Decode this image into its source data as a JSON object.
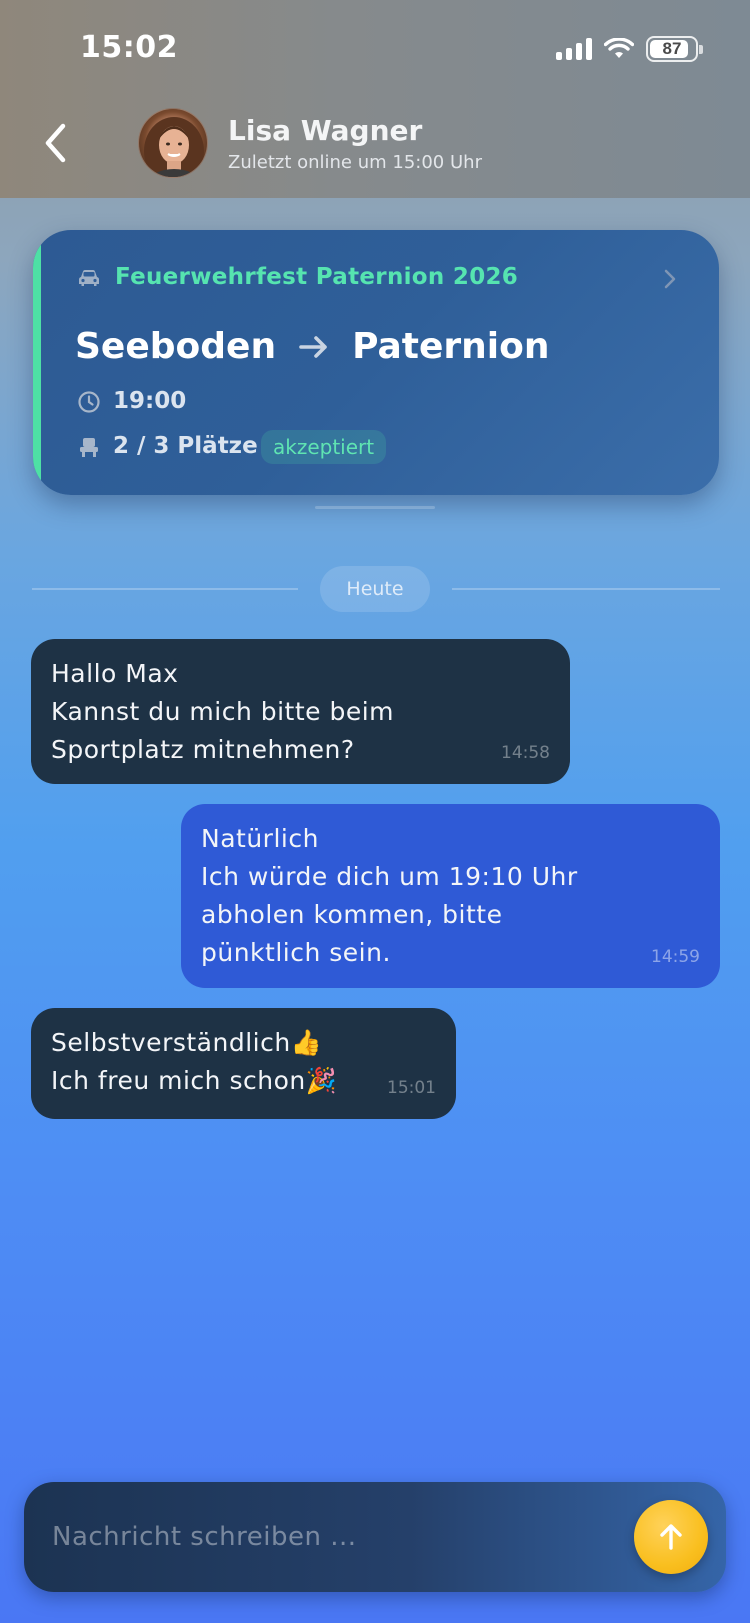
{
  "status_bar": {
    "time": "15:02",
    "battery": "87",
    "battery_level": 0.87
  },
  "header": {
    "contact_name": "Lisa Wagner",
    "contact_status": "Zuletzt online um 15:00 Uhr",
    "back_icon": "chevron-left-icon",
    "avatar": "avatar"
  },
  "ride_card": {
    "event": "Feuerwehrfest Paternion 2026",
    "from": "Seeboden",
    "to": "Paternion",
    "time": "19:00",
    "seats": "2 / 3 Plätze",
    "status": "akzeptiert",
    "accent_color": "#4ee0a5",
    "icons": [
      "car-icon",
      "arrow-right-icon",
      "clock-icon",
      "seat-icon",
      "chevron-right-icon"
    ]
  },
  "divider": {
    "label": "Heute"
  },
  "messages": [
    {
      "direction": "incoming",
      "lines": [
        "Hallo Max",
        "Kannst du mich bitte beim",
        "Sportplatz mitnehmen?"
      ],
      "time": "14:58"
    },
    {
      "direction": "outgoing",
      "lines": [
        "Natürlich",
        "Ich würde dich um 19:10 Uhr",
        "abholen kommen, bitte",
        "pünktlich sein."
      ],
      "time": "14:59"
    },
    {
      "direction": "incoming",
      "lines": [
        "Selbstverständlich👍",
        "Ich freu mich schon🎉"
      ],
      "time": "15:01"
    }
  ],
  "composer": {
    "placeholder": "Nachricht schreiben ...",
    "value": "",
    "send_icon": "arrow-up-icon",
    "send_color": "#f9bf1f"
  },
  "colors": {
    "incoming_bubble": "#1e3245",
    "outgoing_bubble": "#2f5ad6"
  }
}
